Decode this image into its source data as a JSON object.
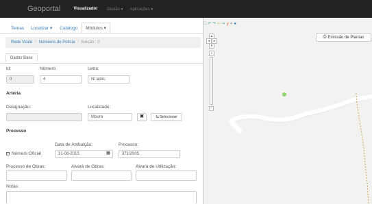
{
  "navbar": {
    "brand": "Geoportal",
    "items": [
      "Visualizador",
      "Gestão ▾",
      "Aplicações ▾"
    ]
  },
  "menu": {
    "items": [
      "Temas",
      "Localizar ▾",
      "Catálogo",
      "Módulos ▾"
    ]
  },
  "breadcrumb": {
    "items": [
      "Rede Viária",
      "Números de Polícia",
      "Edição : 0"
    ]
  },
  "tab": {
    "label": "Dados Base"
  },
  "form": {
    "id_label": "Id:",
    "id_value": "0",
    "numero_label": "Número:",
    "numero_value": "4",
    "letra_label": "Letra:",
    "letra_value": "N/ aplic.",
    "arteria_title": "Artéria",
    "designacao_label": "Designação:",
    "designacao_value": "",
    "localidade_label": "Localidade:",
    "localidade_value": "Moura",
    "clear_btn": "✖",
    "select_btn": "Selecionar",
    "processo_title": "Processo",
    "data_label": "Data de Atribuição:",
    "data_value": "31-08-2015",
    "processo_label": "Processo:",
    "processo_value": "371/2005",
    "numero_oficial_label": "Número Oficial",
    "numero_oficial_checked": true,
    "proc_obras_label": "Processo de Obras:",
    "alvara_obras_label": "Alvará de Obras:",
    "alvara_util_label": "Alvará de Utilização:",
    "notas_label": "Notas:"
  },
  "map": {
    "print_btn": "Emissão de Plantas",
    "marker_color": "#8fd36f"
  }
}
